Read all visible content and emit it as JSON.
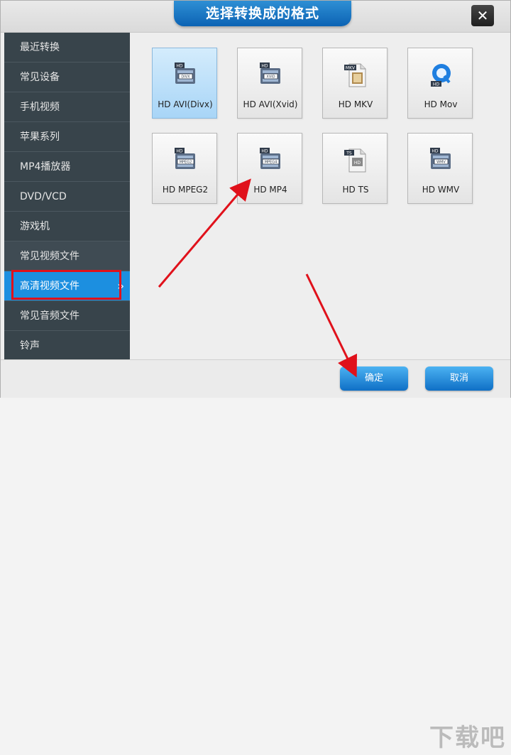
{
  "dialog": {
    "title": "选择转换成的格式",
    "close_glyph": "✕"
  },
  "sidebar": {
    "items": [
      {
        "label": "最近转换"
      },
      {
        "label": "常见设备"
      },
      {
        "label": "手机视频"
      },
      {
        "label": "苹果系列"
      },
      {
        "label": "MP4播放器"
      },
      {
        "label": "DVD/VCD"
      },
      {
        "label": "游戏机"
      },
      {
        "label": "常见视频文件"
      },
      {
        "label": "高清视频文件",
        "selected": true
      },
      {
        "label": "常见音频文件"
      },
      {
        "label": "铃声"
      }
    ],
    "selected_chevron": "»"
  },
  "formats": [
    {
      "label": "HD AVI(Divx)",
      "icon_text": "DIVX",
      "badge": "HD",
      "selected": true
    },
    {
      "label": "HD AVI(Xvid)",
      "icon_text": "XVID",
      "badge": "HD"
    },
    {
      "label": "HD MKV",
      "icon_text": "",
      "badge": "MKV"
    },
    {
      "label": "HD Mov",
      "icon_text": "",
      "badge": "HD"
    },
    {
      "label": "HD MPEG2",
      "icon_text": "MPEG2",
      "badge": "HD"
    },
    {
      "label": "HD MP4",
      "icon_text": "MPEG4",
      "badge": "HD"
    },
    {
      "label": "HD TS",
      "icon_text": "HD",
      "badge": "TS"
    },
    {
      "label": "HD WMV",
      "icon_text": "WMV",
      "badge": "HD"
    }
  ],
  "buttons": {
    "ok": "确定",
    "cancel": "取消"
  },
  "watermark": "下载吧",
  "colors": {
    "accent": "#1c8fe0",
    "annotation": "#e0111b"
  }
}
